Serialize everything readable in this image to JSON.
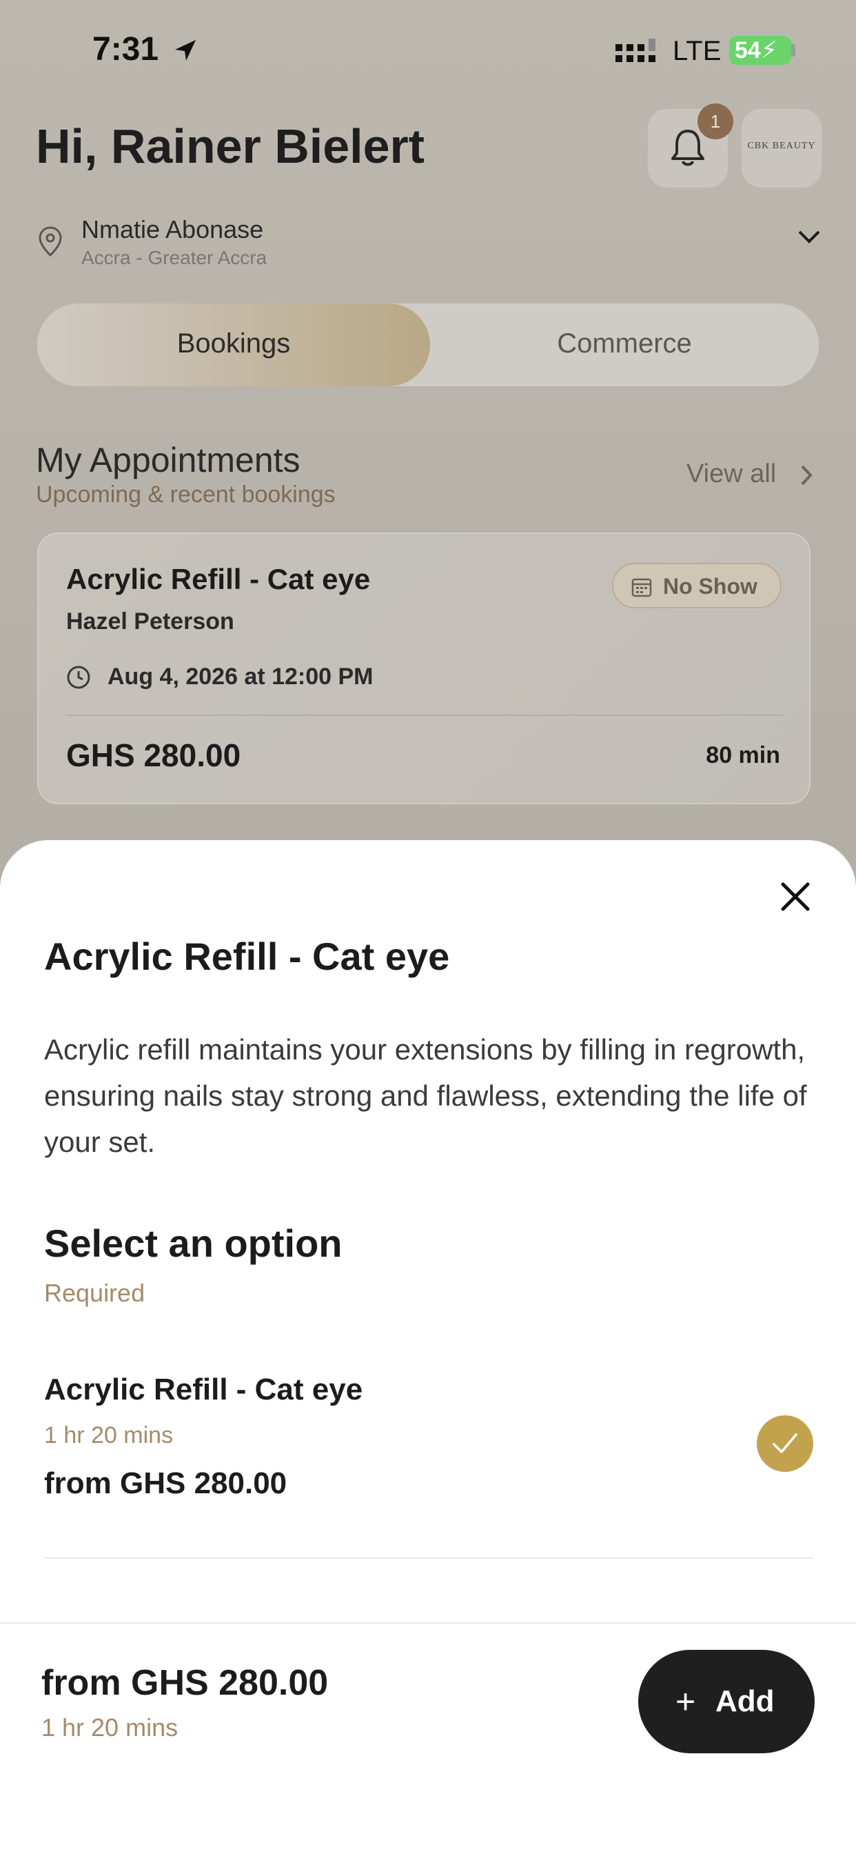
{
  "status_bar": {
    "time": "7:31",
    "network": "LTE",
    "battery": "54"
  },
  "header": {
    "greeting": "Hi, Rainer Bielert",
    "notification_count": "1",
    "logo_text": "CBK BEAUTY"
  },
  "location": {
    "name": "Nmatie Abonase",
    "region": "Accra - Greater Accra"
  },
  "tabs": [
    {
      "label": "Bookings",
      "active": true
    },
    {
      "label": "Commerce",
      "active": false
    }
  ],
  "appointments": {
    "title": "My Appointments",
    "subtitle": "Upcoming & recent bookings",
    "view_all": "View all",
    "card": {
      "service": "Acrylic Refill - Cat eye",
      "client": "Hazel Peterson",
      "status": "No Show",
      "datetime": "Aug 4, 2026 at 12:00 PM",
      "price": "GHS 280.00",
      "duration": "80 min"
    }
  },
  "sheet": {
    "title": "Acrylic Refill - Cat eye",
    "description": "Acrylic refill maintains your extensions by filling in regrowth, ensuring nails stay strong and flawless, extending the life of your set.",
    "option_heading": "Select an option",
    "required_label": "Required",
    "option": {
      "name": "Acrylic Refill - Cat eye",
      "duration": "1 hr 20 mins",
      "price": "from GHS 280.00",
      "selected": true
    },
    "footer": {
      "total": "from GHS 280.00",
      "duration": "1 hr 20 mins",
      "add_label": "Add",
      "add_icon": "+"
    }
  },
  "colors": {
    "accent": "#c3a24e",
    "muted_accent": "#a58a6a",
    "button_dark": "#1f1f1f"
  }
}
